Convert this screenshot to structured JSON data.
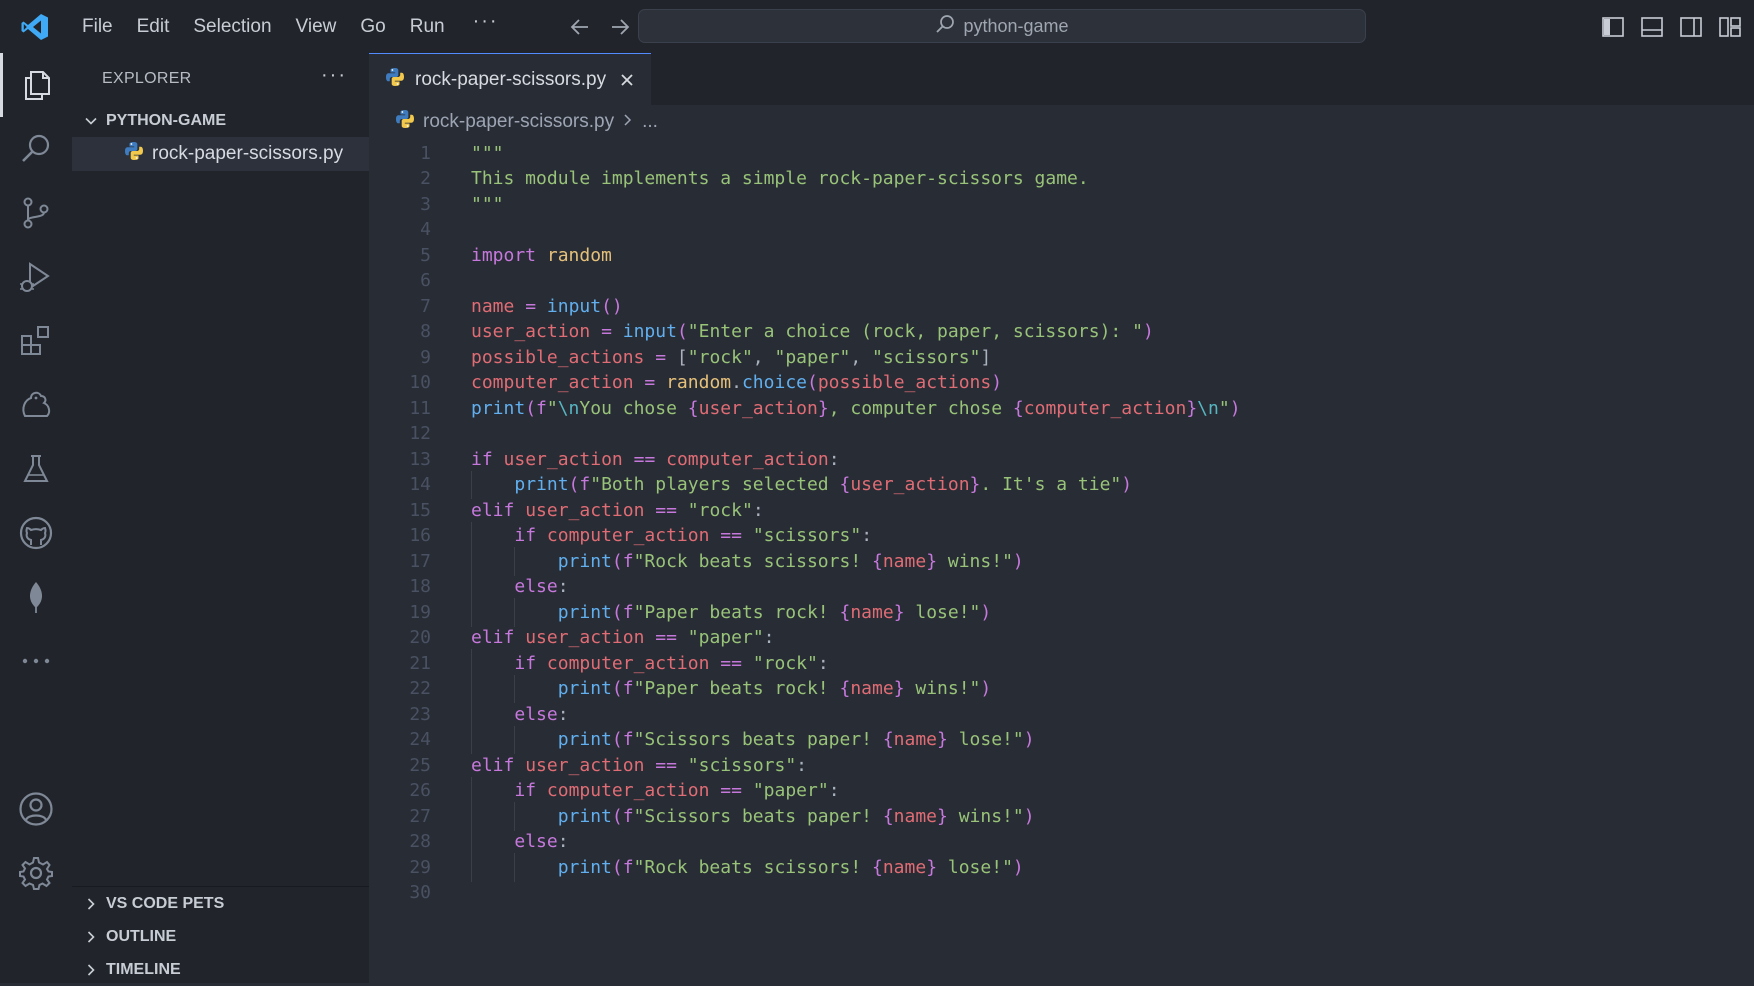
{
  "titlebar": {
    "menu": [
      "File",
      "Edit",
      "Selection",
      "View",
      "Go",
      "Run",
      "···"
    ],
    "search_text": "python-game"
  },
  "sidebar": {
    "title": "EXPLORER",
    "more": "···",
    "folder": "PYTHON-GAME",
    "file": "rock-paper-scissors.py",
    "bottom_sections": [
      "VS CODE PETS",
      "OUTLINE",
      "TIMELINE"
    ]
  },
  "editor": {
    "tab_label": "rock-paper-scissors.py",
    "breadcrumb_file": "rock-paper-scissors.py",
    "breadcrumb_more": "...",
    "line_numbers": [
      "1",
      "2",
      "3",
      "4",
      "5",
      "6",
      "7",
      "8",
      "9",
      "10",
      "11",
      "12",
      "13",
      "14",
      "15",
      "16",
      "17",
      "18",
      "19",
      "20",
      "21",
      "22",
      "23",
      "24",
      "25",
      "26",
      "27",
      "28",
      "29",
      "30"
    ],
    "code_lines": [
      "\"\"\"",
      "This module implements a simple rock-paper-scissors game.",
      "\"\"\"",
      "",
      "import random",
      "",
      "name = input()",
      "user_action = input(\"Enter a choice (rock, paper, scissors): \")",
      "possible_actions = [\"rock\", \"paper\", \"scissors\"]",
      "computer_action = random.choice(possible_actions)",
      "print(f\"\\nYou chose {user_action}, computer chose {computer_action}\\n\")",
      "",
      "if user_action == computer_action:",
      "    print(f\"Both players selected {user_action}. It's a tie\")",
      "elif user_action == \"rock\":",
      "    if computer_action == \"scissors\":",
      "        print(f\"Rock beats scissors! {name} wins!\")",
      "    else:",
      "        print(f\"Paper beats rock! {name} lose!\")",
      "elif user_action == \"paper\":",
      "    if computer_action == \"rock\":",
      "        print(f\"Paper beats rock! {name} wins!\")",
      "    else:",
      "        print(f\"Scissors beats paper! {name} lose!\")",
      "elif user_action == \"scissors\":",
      "    if computer_action == \"paper\":",
      "        print(f\"Scissors beats paper! {name} wins!\")",
      "    else:",
      "        print(f\"Rock beats scissors! {name} lose!\")",
      ""
    ]
  },
  "activity_icons": [
    "explorer-icon",
    "search-icon",
    "source-control-icon",
    "run-debug-icon",
    "extensions-icon",
    "pets-icon",
    "testing-icon",
    "github-icon",
    "leaf-icon",
    "more-icon",
    "account-icon",
    "settings-icon"
  ],
  "colors": {
    "keyword": "#c678dd",
    "string": "#98c379",
    "variable": "#e06c75",
    "function": "#61afef",
    "module": "#e5c07b",
    "escape": "#56b6c2"
  }
}
